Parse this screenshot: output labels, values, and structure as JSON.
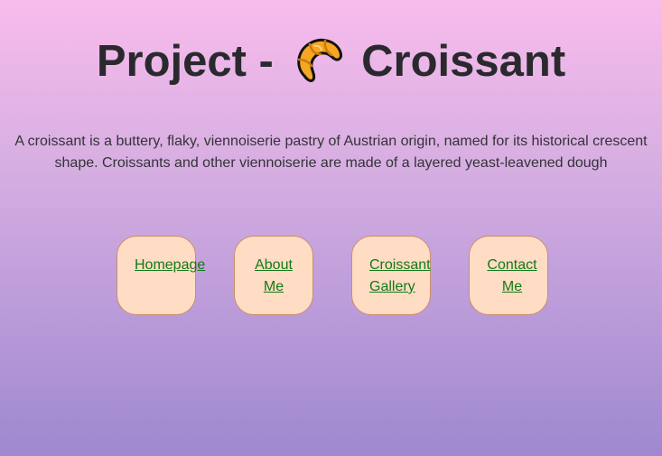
{
  "header": {
    "title_prefix": "Project -",
    "title_icon": "croissant-emoji",
    "title_suffix": "Croissant"
  },
  "intro": {
    "text": "A croissant is a buttery, flaky, viennoiserie pastry of Austrian origin, named for its historical crescent shape. Croissants and other viennoiserie are made of a layered yeast-leavened dough"
  },
  "nav": {
    "items": [
      {
        "label_line1": "Homepage",
        "label_line2": ""
      },
      {
        "label_line1": "About",
        "label_line2": "Me"
      },
      {
        "label_line1": "Croissant",
        "label_line2": "Gallery"
      },
      {
        "label_line1": "Contact",
        "label_line2": "Me"
      }
    ]
  },
  "colors": {
    "background_top": "#f8bcec",
    "background_bottom": "#9e88cf",
    "nav_box_fill": "#ffdcc4",
    "nav_box_border": "#c88f6c",
    "link": "#137a18",
    "text": "#2a2a2e"
  }
}
